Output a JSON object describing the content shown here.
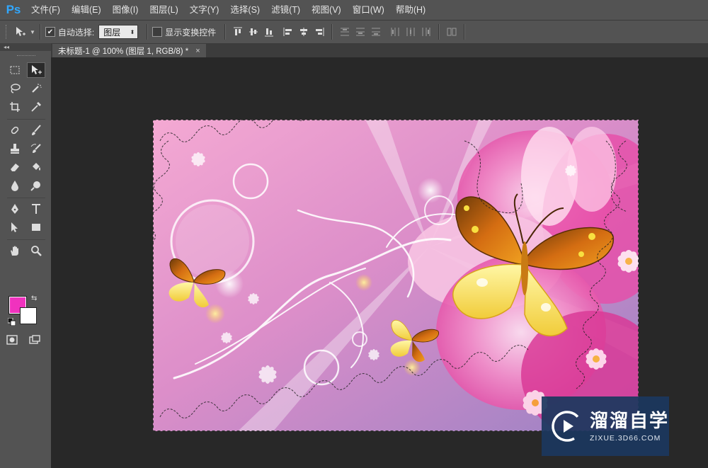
{
  "app": {
    "logo": "Ps",
    "accent_color": "#31a8ff"
  },
  "menu": {
    "items": [
      "文件(F)",
      "编辑(E)",
      "图像(I)",
      "图层(L)",
      "文字(Y)",
      "选择(S)",
      "滤镜(T)",
      "视图(V)",
      "窗口(W)",
      "帮助(H)"
    ]
  },
  "options_bar": {
    "auto_select_label": "自动选择:",
    "auto_select_checked": true,
    "auto_select_target": "图层",
    "show_transform_label": "显示变换控件",
    "show_transform_checked": false
  },
  "document": {
    "tab_title": "未标题-1 @ 100% (图层 1, RGB/8) *",
    "close_glyph": "×"
  },
  "toolbox": {
    "header_glyph": "◂◂",
    "foreground_color": "#f032be",
    "background_color": "#ffffff"
  },
  "watermark": {
    "title": "溜溜自学",
    "subtitle": "ZIXUE.3D66.COM"
  }
}
